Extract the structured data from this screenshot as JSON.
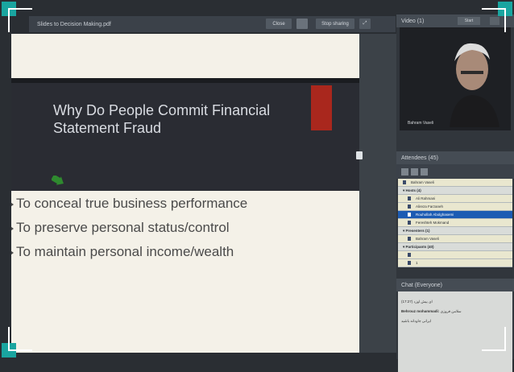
{
  "window": {
    "title": "Slides to Decision Making.pdf",
    "hide_label": "Close",
    "stop_sharing_label": "Stop sharing"
  },
  "slide": {
    "title_line1": "Why Do People Commit Financial",
    "title_line2": "Statement Fraud",
    "bullets": [
      "To conceal true business performance",
      "To preserve personal status/control",
      "To maintain personal income/wealth"
    ]
  },
  "video": {
    "panel_title": "Video (1)",
    "start_label": "Start",
    "caption": "Bahram Vaseli"
  },
  "attendees": {
    "panel_title": "Attendees (45)",
    "top_user": "Bahram Vaseli",
    "groups": [
      {
        "label": "Hosts (4)",
        "people": [
          "Ali Rahmani",
          "Alireza Farzaneh",
          "Rouhollah Abolghasemi",
          "Fereshteh Mokmand"
        ],
        "selected": 2
      },
      {
        "label": "Presenters (1)",
        "people": [
          "Bahram Vaseli"
        ],
        "selected": -1
      },
      {
        "label": "Participants (40)",
        "people": [
          "",
          "1"
        ],
        "selected": -1
      }
    ]
  },
  "chat": {
    "panel_title": "Chat (Everyone)",
    "line1": "(17:27) ای بیش اوزد",
    "line2_name": "Behrouz mohammadi:",
    "line2_text": "سلامن فروزی",
    "line3": "ایرانی جاودانه باشید"
  },
  "colors": {
    "accent": "#1aa5a0",
    "selected_row": "#1c5bb3",
    "slide_red": "#a9271d"
  }
}
